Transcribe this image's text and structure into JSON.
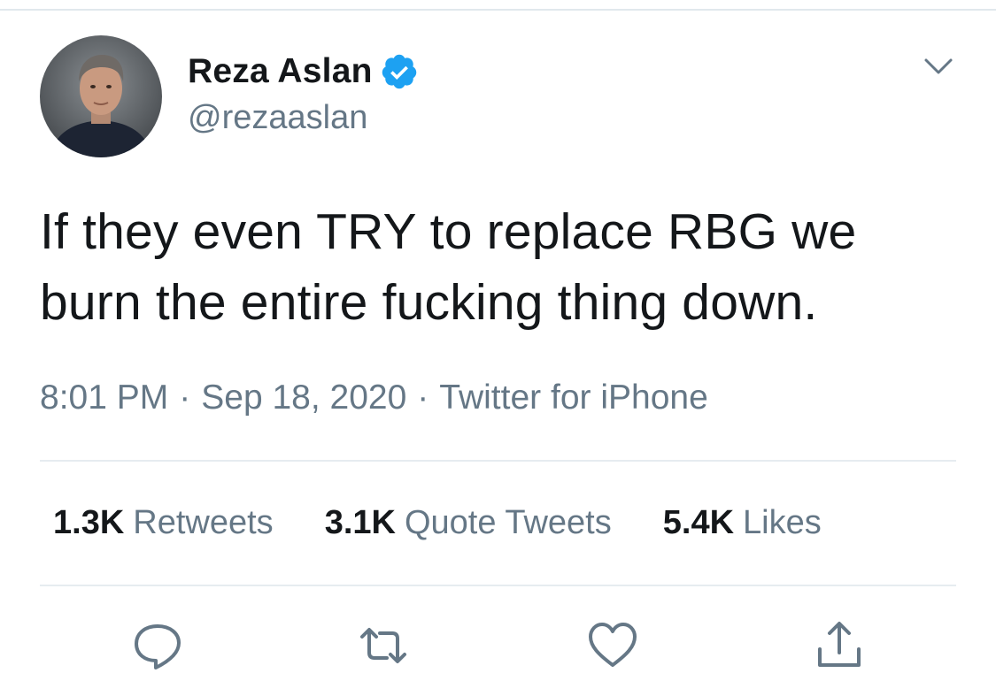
{
  "author": {
    "display_name": "Reza Aslan",
    "handle": "@rezaaslan",
    "verified": true,
    "avatar_icon": "profile-photo"
  },
  "tweet": {
    "text": "If they even TRY to replace RBG we burn the entire fucking thing down.",
    "time": "8:01 PM",
    "date": "Sep 18, 2020",
    "source": "Twitter for iPhone",
    "separator": "·"
  },
  "stats": {
    "retweets": {
      "count": "1.3K",
      "label": "Retweets"
    },
    "quote_tweets": {
      "count": "3.1K",
      "label": "Quote Tweets"
    },
    "likes": {
      "count": "5.4K",
      "label": "Likes"
    }
  },
  "actions": {
    "reply_icon": "reply-icon",
    "retweet_icon": "retweet-icon",
    "like_icon": "heart-icon",
    "share_icon": "share-icon"
  },
  "colors": {
    "verified_blue": "#1da1f2",
    "text_primary": "#14171a",
    "text_secondary": "#657786",
    "divider": "#e6ecf0"
  }
}
